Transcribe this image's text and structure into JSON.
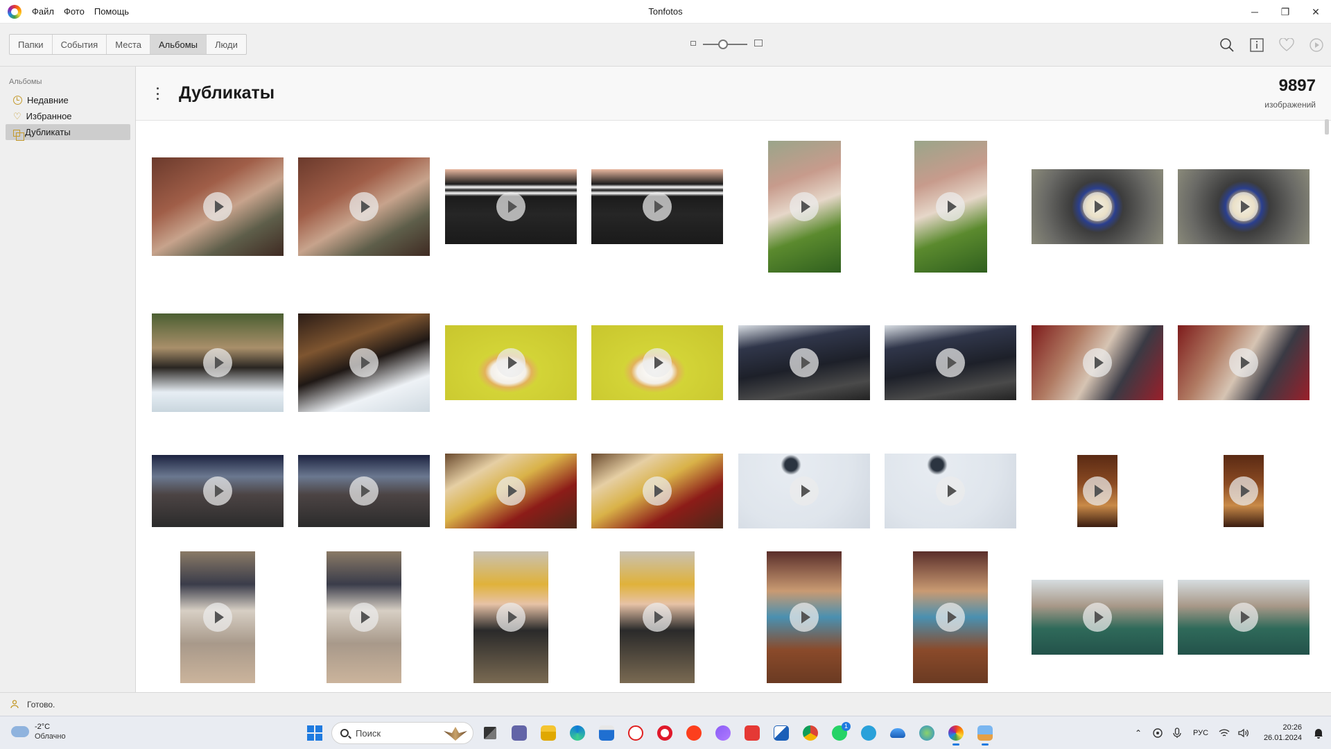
{
  "window": {
    "title": "Tonfotos",
    "menu": [
      "Файл",
      "Фото",
      "Помощь"
    ],
    "controls": {
      "minimize": "─",
      "maximize": "❐",
      "close": "✕"
    }
  },
  "toolbar": {
    "tabs": [
      {
        "label": "Папки",
        "active": false
      },
      {
        "label": "События",
        "active": false
      },
      {
        "label": "Места",
        "active": false
      },
      {
        "label": "Альбомы",
        "active": true
      },
      {
        "label": "Люди",
        "active": false
      }
    ],
    "zoom_level": 0.45,
    "icons": [
      "search-icon",
      "info-icon",
      "heart-icon",
      "play-circle-icon"
    ]
  },
  "sidebar": {
    "header": "Альбомы",
    "items": [
      {
        "label": "Недавние",
        "icon": "clock-icon",
        "selected": false
      },
      {
        "label": "Избранное",
        "icon": "heart-icon",
        "selected": false
      },
      {
        "label": "Дубликаты",
        "icon": "duplicates-icon",
        "selected": true
      }
    ]
  },
  "album": {
    "title": "Дубликаты",
    "count": "9897",
    "count_label": "изображений"
  },
  "status": {
    "text": "Готово."
  },
  "taskbar": {
    "weather": {
      "temp": "-2°C",
      "desc": "Облачно"
    },
    "search_placeholder": "Поиск",
    "lang": "РУС",
    "time": "20:26",
    "date": "26.01.2024",
    "badge": "1"
  },
  "colors": {
    "accent": "#c49a2c",
    "tab_active": "#d8d8d8",
    "taskbar_accent": "#1f7be0"
  }
}
